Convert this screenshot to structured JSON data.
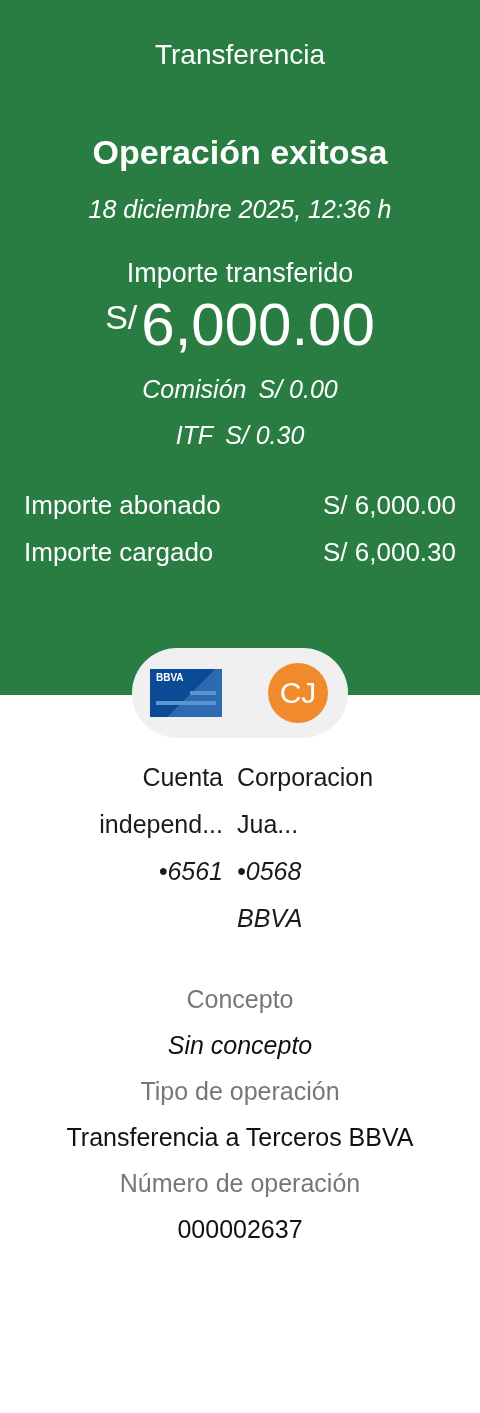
{
  "header": {
    "title": "Transferencia",
    "status": "Operación exitosa",
    "datetime": "18 diciembre 2025, 12:36 h",
    "amount_label": "Importe transferido",
    "amount_currency": "S/",
    "amount_value": "6,000.00",
    "fees": [
      {
        "label": "Comisión",
        "value": "S/ 0.00"
      },
      {
        "label": "ITF",
        "value": "S/ 0.30"
      }
    ],
    "totals": [
      {
        "label": "Importe abonado",
        "value": "S/ 6,000.00"
      },
      {
        "label": "Importe cargado",
        "value": "S/ 6,000.30"
      }
    ]
  },
  "parties": {
    "origin": {
      "logo": "BBVA",
      "name": "Cuenta independ...",
      "account": "•6561"
    },
    "destination": {
      "initials": "CJ",
      "name": "Corporacion Jua...",
      "account": "•0568",
      "bank": "BBVA"
    }
  },
  "details": [
    {
      "label": "Concepto",
      "value": "Sin concepto",
      "kind": "italic"
    },
    {
      "label": "Tipo de operación",
      "value": "Transferencia a Terceros BBVA",
      "kind": "plain"
    },
    {
      "label": "Número de operación",
      "value": "000002637",
      "kind": "plain"
    }
  ]
}
